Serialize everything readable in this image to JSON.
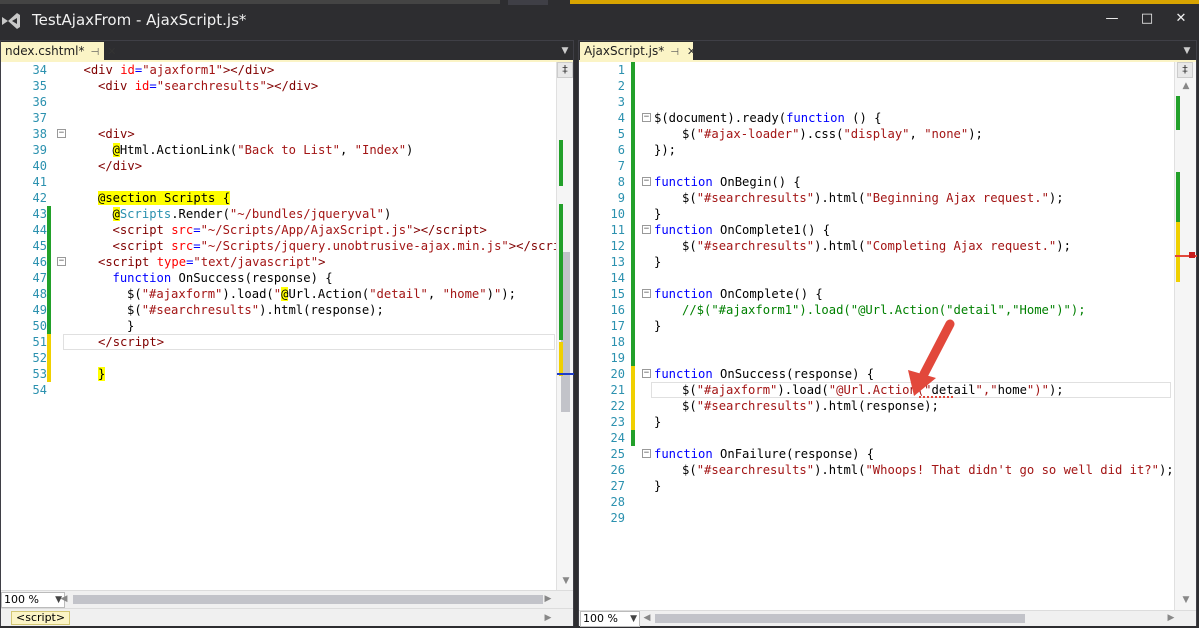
{
  "window": {
    "title": "TestAjaxFrom - AjaxScript.js*",
    "minimize_glyph": "—",
    "maximize_glyph": "□",
    "close_glyph": "✕"
  },
  "left_pane": {
    "tab_label": "ndex.cshtml*",
    "pin_glyph": "⊣",
    "close_glyph": "✕",
    "zoom": "100 %",
    "nav_crumb": "<script>",
    "lines": [
      {
        "n": "34",
        "chg": "none",
        "fold": "",
        "indent": 1,
        "segs": [
          [
            "tag",
            "<"
          ],
          [
            "tag",
            "div"
          ],
          [
            "attr",
            " id"
          ],
          [
            "punct",
            "="
          ],
          [
            "str",
            "\"ajaxform1\""
          ],
          [
            "tag",
            ">"
          ],
          [
            "tag",
            "</"
          ],
          [
            "tag",
            "div"
          ],
          [
            "tag",
            ">"
          ]
        ]
      },
      {
        "n": "35",
        "chg": "none",
        "fold": "",
        "indent": 2,
        "segs": [
          [
            "tag",
            "<"
          ],
          [
            "tag",
            "div"
          ],
          [
            "attr",
            " id"
          ],
          [
            "punct",
            "="
          ],
          [
            "str",
            "\"searchresults\""
          ],
          [
            "tag",
            ">"
          ],
          [
            "tag",
            "</"
          ],
          [
            "tag",
            "div"
          ],
          [
            "tag",
            ">"
          ]
        ]
      },
      {
        "n": "36",
        "chg": "none",
        "fold": "",
        "indent": 0,
        "segs": []
      },
      {
        "n": "37",
        "chg": "none",
        "fold": "",
        "indent": 0,
        "segs": []
      },
      {
        "n": "38",
        "chg": "none",
        "fold": "−",
        "indent": 2,
        "segs": [
          [
            "tag",
            "<"
          ],
          [
            "tag",
            "div"
          ],
          [
            "tag",
            ">"
          ]
        ]
      },
      {
        "n": "39",
        "chg": "none",
        "fold": "",
        "indent": 3,
        "segs": [
          [
            "razor",
            "@"
          ],
          [
            "plain",
            "Html.ActionLink("
          ],
          [
            "str",
            "\"Back to List\""
          ],
          [
            "plain",
            ", "
          ],
          [
            "str",
            "\"Index\""
          ],
          [
            "plain",
            ")"
          ]
        ]
      },
      {
        "n": "40",
        "chg": "none",
        "fold": "",
        "indent": 2,
        "segs": [
          [
            "tag",
            "</"
          ],
          [
            "tag",
            "div"
          ],
          [
            "tag",
            ">"
          ]
        ]
      },
      {
        "n": "41",
        "chg": "none",
        "fold": "",
        "indent": 0,
        "segs": []
      },
      {
        "n": "42",
        "chg": "none",
        "fold": "",
        "indent": 2,
        "segs": [
          [
            "razor",
            "@section Scripts {"
          ]
        ]
      },
      {
        "n": "43",
        "chg": "none",
        "fold": "",
        "indent": 3,
        "segs": [
          [
            "razor",
            "@"
          ],
          [
            "cls",
            "Scripts"
          ],
          [
            "plain",
            ".Render("
          ],
          [
            "str",
            "\"~/bundles/jqueryval\""
          ],
          [
            "plain",
            ")"
          ]
        ]
      },
      {
        "n": "44",
        "chg": "none",
        "fold": "",
        "indent": 3,
        "segs": [
          [
            "tag",
            "<"
          ],
          [
            "tag",
            "script"
          ],
          [
            "attr",
            " src"
          ],
          [
            "punct",
            "="
          ],
          [
            "str",
            "\"~/Scripts/App/AjaxScript.js\""
          ],
          [
            "tag",
            ">"
          ],
          [
            "tag",
            "</"
          ],
          [
            "tag",
            "script"
          ],
          [
            "tag",
            ">"
          ]
        ]
      },
      {
        "n": "45",
        "chg": "none",
        "fold": "",
        "indent": 3,
        "segs": [
          [
            "tag",
            "<"
          ],
          [
            "tag",
            "script"
          ],
          [
            "attr",
            " src"
          ],
          [
            "punct",
            "="
          ],
          [
            "str",
            "\"~/Scripts/jquery.unobtrusive-ajax.min.js\""
          ],
          [
            "tag",
            ">"
          ],
          [
            "tag",
            "</"
          ],
          [
            "tag",
            "scrip"
          ]
        ]
      },
      {
        "n": "46",
        "chg": "none",
        "fold": "−",
        "indent": 2,
        "segs": [
          [
            "tag",
            "<"
          ],
          [
            "tag",
            "script"
          ],
          [
            "attr",
            " type"
          ],
          [
            "punct",
            "="
          ],
          [
            "str",
            "\"text/javascript\""
          ],
          [
            "tag",
            ">"
          ]
        ]
      },
      {
        "n": "47",
        "chg": "none",
        "fold": "",
        "indent": 3,
        "segs": [
          [
            "kw",
            "function"
          ],
          [
            "plain",
            " OnSuccess(response) {"
          ]
        ]
      },
      {
        "n": "48",
        "chg": "none",
        "fold": "",
        "indent": 4,
        "segs": [
          [
            "plain",
            "$("
          ],
          [
            "str",
            "\"#ajaxform\""
          ],
          [
            "plain",
            ").load("
          ],
          [
            "str",
            "\""
          ],
          [
            "razor",
            "@"
          ],
          [
            "plain",
            "Url.Action("
          ],
          [
            "str",
            "\"detail\""
          ],
          [
            "plain",
            ", "
          ],
          [
            "str",
            "\"home\""
          ],
          [
            "plain",
            ")"
          ],
          [
            "str",
            "\""
          ],
          [
            "plain",
            ");"
          ]
        ]
      },
      {
        "n": "49",
        "chg": "none",
        "fold": "",
        "indent": 4,
        "segs": [
          [
            "plain",
            "$("
          ],
          [
            "str",
            "\"#searchresults\""
          ],
          [
            "plain",
            ").html(response);"
          ]
        ]
      },
      {
        "n": "50",
        "chg": "none",
        "fold": "",
        "indent": 4,
        "segs": [
          [
            "plain",
            "}"
          ]
        ]
      },
      {
        "n": "51",
        "chg": "none",
        "fold": "",
        "indent": 2,
        "segs": [
          [
            "tag",
            "</"
          ],
          [
            "tag",
            "script"
          ],
          [
            "tag",
            ">"
          ]
        ]
      },
      {
        "n": "52",
        "chg": "none",
        "fold": "",
        "indent": 0,
        "segs": []
      },
      {
        "n": "53",
        "chg": "none",
        "fold": "",
        "indent": 2,
        "segs": [
          [
            "razor",
            "}"
          ]
        ]
      },
      {
        "n": "54",
        "chg": "none",
        "fold": "",
        "indent": 0,
        "segs": []
      }
    ]
  },
  "right_pane": {
    "tab_label": "AjaxScript.js*",
    "pin_glyph": "⊣",
    "close_glyph": "✕",
    "zoom": "100 %",
    "lines": [
      {
        "n": "1",
        "indent": 0,
        "segs": []
      },
      {
        "n": "2",
        "indent": 0,
        "segs": []
      },
      {
        "n": "3",
        "indent": 0,
        "segs": []
      },
      {
        "n": "4",
        "indent": 0,
        "fold": "−",
        "segs": [
          [
            "plain",
            "$(document).ready("
          ],
          [
            "kw",
            "function"
          ],
          [
            "plain",
            " () {"
          ]
        ]
      },
      {
        "n": "5",
        "indent": 1,
        "segs": [
          [
            "plain",
            "$("
          ],
          [
            "str",
            "\"#ajax-loader\""
          ],
          [
            "plain",
            ").css("
          ],
          [
            "str",
            "\"display\""
          ],
          [
            "plain",
            ", "
          ],
          [
            "str",
            "\"none\""
          ],
          [
            "plain",
            ");"
          ]
        ]
      },
      {
        "n": "6",
        "indent": 0,
        "segs": [
          [
            "plain",
            "});"
          ]
        ]
      },
      {
        "n": "7",
        "indent": 0,
        "segs": []
      },
      {
        "n": "8",
        "indent": 0,
        "fold": "−",
        "segs": [
          [
            "kw",
            "function"
          ],
          [
            "plain",
            " OnBegin() {"
          ]
        ]
      },
      {
        "n": "9",
        "indent": 1,
        "segs": [
          [
            "plain",
            "$("
          ],
          [
            "str",
            "\"#searchresults\""
          ],
          [
            "plain",
            ").html("
          ],
          [
            "str",
            "\"Beginning Ajax request.\""
          ],
          [
            "plain",
            ");"
          ]
        ]
      },
      {
        "n": "10",
        "indent": 0,
        "segs": [
          [
            "plain",
            "}"
          ]
        ]
      },
      {
        "n": "11",
        "indent": 0,
        "fold": "−",
        "segs": [
          [
            "kw",
            "function"
          ],
          [
            "plain",
            " OnComplete1() {"
          ]
        ]
      },
      {
        "n": "12",
        "indent": 1,
        "segs": [
          [
            "plain",
            "$("
          ],
          [
            "str",
            "\"#searchresults\""
          ],
          [
            "plain",
            ").html("
          ],
          [
            "str",
            "\"Completing Ajax request.\""
          ],
          [
            "plain",
            ");"
          ]
        ]
      },
      {
        "n": "13",
        "indent": 0,
        "segs": [
          [
            "plain",
            "}"
          ]
        ]
      },
      {
        "n": "14",
        "indent": 0,
        "segs": []
      },
      {
        "n": "15",
        "indent": 0,
        "fold": "−",
        "segs": [
          [
            "kw",
            "function"
          ],
          [
            "plain",
            " OnComplete() {"
          ]
        ]
      },
      {
        "n": "16",
        "indent": 1,
        "segs": [
          [
            "cm",
            "//$(\"#ajaxform1\").load(\"@Url.Action(\"detail\",\"Home\")\");"
          ]
        ]
      },
      {
        "n": "17",
        "indent": 0,
        "segs": [
          [
            "plain",
            "}"
          ]
        ]
      },
      {
        "n": "18",
        "indent": 0,
        "segs": []
      },
      {
        "n": "19",
        "indent": 0,
        "segs": []
      },
      {
        "n": "20",
        "indent": 0,
        "fold": "−",
        "segs": [
          [
            "kw",
            "function"
          ],
          [
            "plain",
            " OnSuccess(response) {"
          ]
        ]
      },
      {
        "n": "21",
        "indent": 1,
        "segs": [
          [
            "plain",
            "$("
          ],
          [
            "str",
            "\"#ajaxform\""
          ],
          [
            "plain",
            ").load("
          ],
          [
            "str",
            "\"@Url.Action(\""
          ],
          [
            "plain",
            "detail"
          ],
          [
            "str",
            "\",\""
          ],
          [
            "plain",
            "home"
          ],
          [
            "str",
            "\")\""
          ],
          [
            "plain",
            ");"
          ]
        ]
      },
      {
        "n": "22",
        "indent": 1,
        "segs": [
          [
            "plain",
            "$("
          ],
          [
            "str",
            "\"#searchresults\""
          ],
          [
            "plain",
            ").html(response);"
          ]
        ]
      },
      {
        "n": "23",
        "indent": 0,
        "segs": [
          [
            "plain",
            "}"
          ]
        ]
      },
      {
        "n": "24",
        "indent": 0,
        "segs": []
      },
      {
        "n": "25",
        "indent": 0,
        "fold": "−",
        "segs": [
          [
            "kw",
            "function"
          ],
          [
            "plain",
            " OnFailure(response) {"
          ]
        ]
      },
      {
        "n": "26",
        "indent": 1,
        "segs": [
          [
            "plain",
            "$("
          ],
          [
            "str",
            "\"#searchresults\""
          ],
          [
            "plain",
            ").html("
          ],
          [
            "str",
            "\"Whoops! That didn't go so well did it?\""
          ],
          [
            "plain",
            ");"
          ]
        ]
      },
      {
        "n": "27",
        "indent": 0,
        "segs": [
          [
            "plain",
            "}"
          ]
        ]
      },
      {
        "n": "28",
        "indent": 0,
        "segs": []
      },
      {
        "n": "29",
        "indent": 0,
        "segs": []
      }
    ]
  },
  "colors": {
    "change_saved": "#22a02a",
    "change_unsaved": "#f0d000",
    "accent_arrow": "#e2483b"
  }
}
